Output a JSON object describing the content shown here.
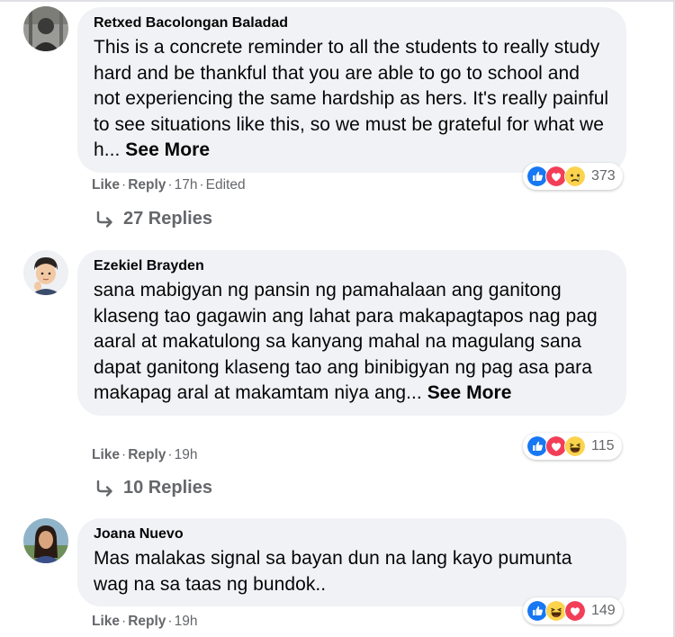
{
  "comments": [
    {
      "author": "Retxed Bacolongan Baladad",
      "text": "This is a concrete reminder to all the students to really study hard and be thankful that you are able to go to school and not experiencing the same hardship as hers. It's really painful to see situations like this, so we must be grateful for what we h... ",
      "see_more": "See More",
      "actions": {
        "like": "Like",
        "reply": "Reply",
        "time": "17h",
        "edited": "Edited"
      },
      "reactions": {
        "icons": [
          "like-icon",
          "love-icon",
          "sad-icon"
        ],
        "count": "373"
      },
      "replies": "27 Replies"
    },
    {
      "author": "Ezekiel Brayden",
      "text": "sana mabigyan ng pansin ng pamahalaan ang ganitong klaseng tao gagawin ang lahat para makapagtapos nag pag aaral at makatulong sa kanyang mahal na magulang sana dapat ganitong klaseng tao ang binibigyan ng pag asa para makapag aral at makamtam niya ang... ",
      "see_more": "See More",
      "actions": {
        "like": "Like",
        "reply": "Reply",
        "time": "19h"
      },
      "reactions": {
        "icons": [
          "like-icon",
          "love-icon",
          "haha-icon"
        ],
        "count": "115"
      },
      "replies": "10 Replies"
    },
    {
      "author": "Joana Nuevo",
      "text": "Mas malakas signal sa bayan dun na lang kayo pumunta wag na sa taas ng bundok..",
      "actions": {
        "like": "Like",
        "reply": "Reply",
        "time": "19h"
      },
      "reactions": {
        "icons": [
          "like-icon",
          "haha-icon",
          "love-icon"
        ],
        "count": "149"
      }
    }
  ],
  "separator": "·",
  "colors": {
    "bubble": "#f0f2f5",
    "secondary_text": "#65676b",
    "like_blue": "#1877f2",
    "love_red": "#f33e58",
    "emoji_yellow": "#fcd34d"
  }
}
